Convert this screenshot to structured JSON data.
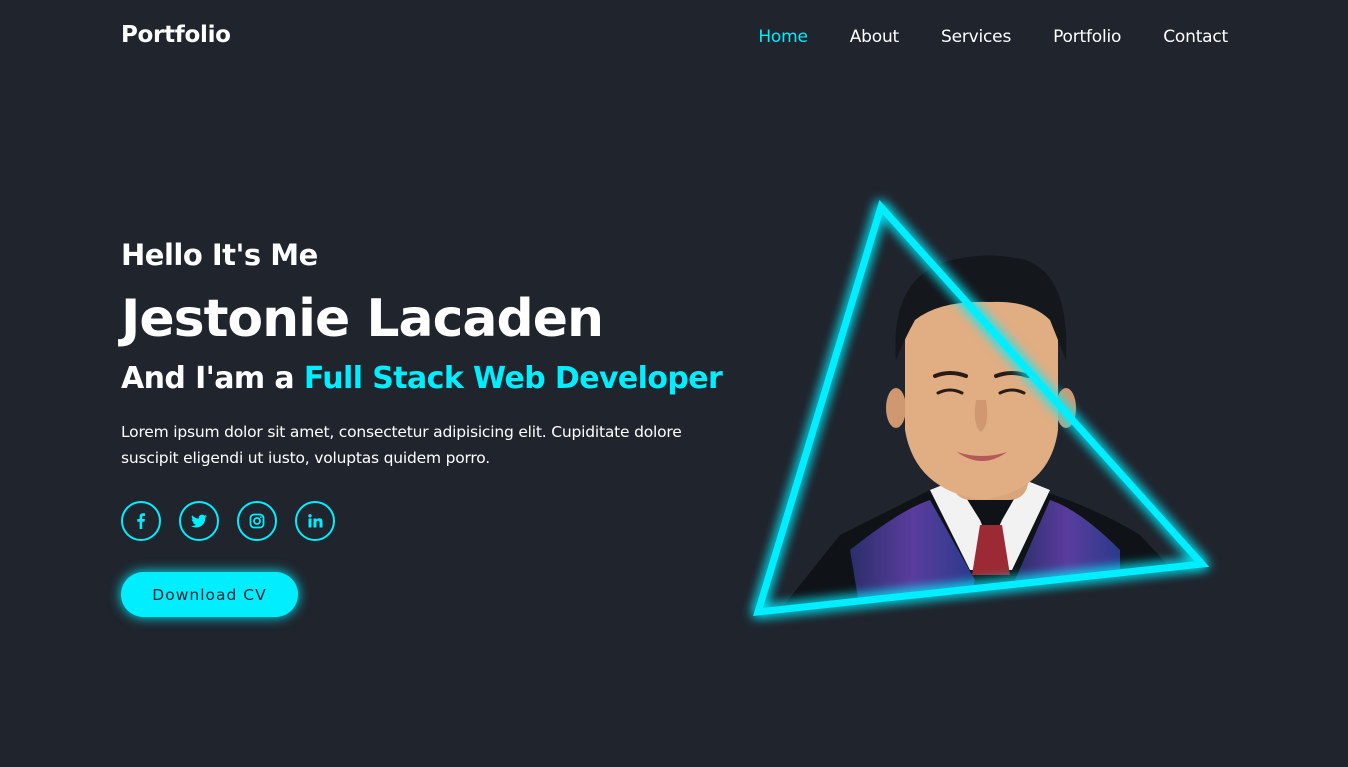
{
  "header": {
    "logo": "Portfolio",
    "nav": [
      {
        "label": "Home",
        "active": true
      },
      {
        "label": "About",
        "active": false
      },
      {
        "label": "Services",
        "active": false
      },
      {
        "label": "Portfolio",
        "active": false
      },
      {
        "label": "Contact",
        "active": false
      }
    ]
  },
  "hero": {
    "greeting": "Hello It's Me",
    "name": "Jestonie Lacaden",
    "role_prefix": "And I'am a ",
    "role_highlight": "Full Stack Web Developer",
    "description": "Lorem ipsum dolor sit amet, consectetur adipisicing elit. Cupiditate dolore suscipit eligendi ut iusto, voluptas quidem porro.",
    "socials": [
      "facebook-icon",
      "twitter-icon",
      "instagram-icon",
      "linkedin-icon"
    ],
    "cta": "Download CV"
  },
  "colors": {
    "background": "#1f242d",
    "accent": "#00eeff",
    "text": "#ffffff"
  }
}
